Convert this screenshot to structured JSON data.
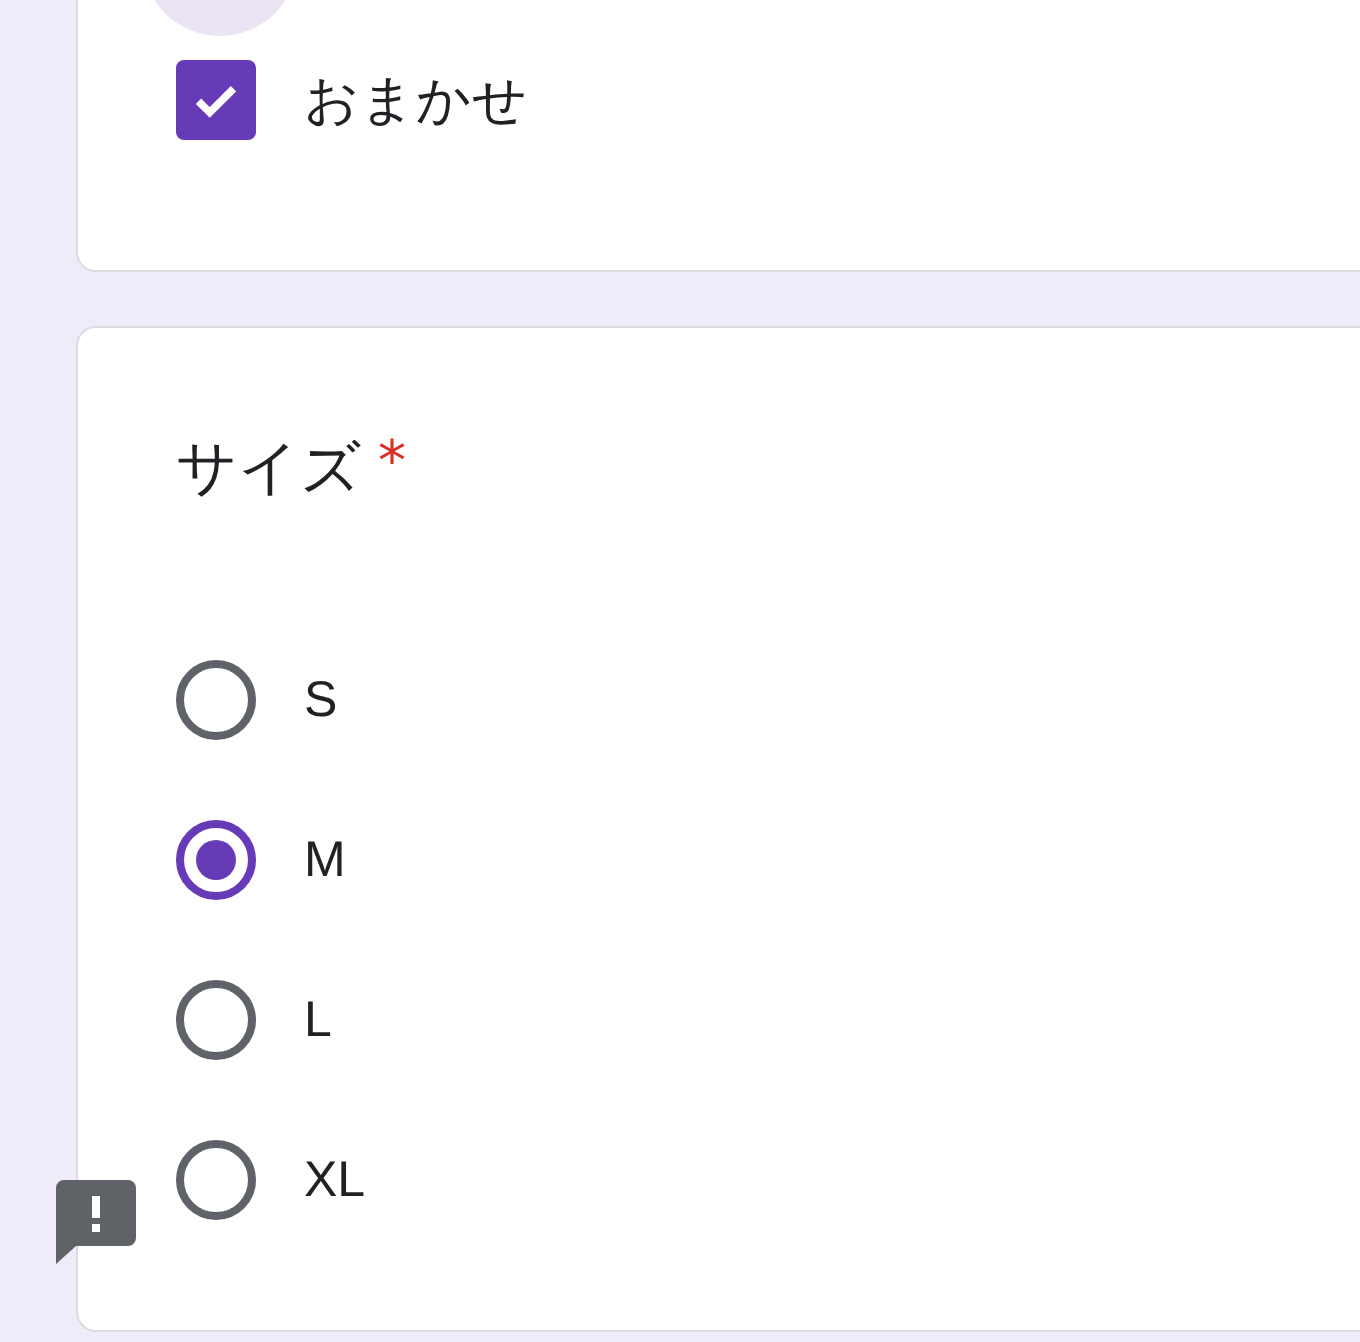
{
  "previous_question": {
    "options": [
      {
        "label": "おまかせ",
        "checked": true
      }
    ]
  },
  "question": {
    "title": "サイズ",
    "required_mark": "*",
    "options": [
      {
        "label": "S",
        "selected": false
      },
      {
        "label": "M",
        "selected": true
      },
      {
        "label": "L",
        "selected": false
      },
      {
        "label": "XL",
        "selected": false
      }
    ]
  }
}
